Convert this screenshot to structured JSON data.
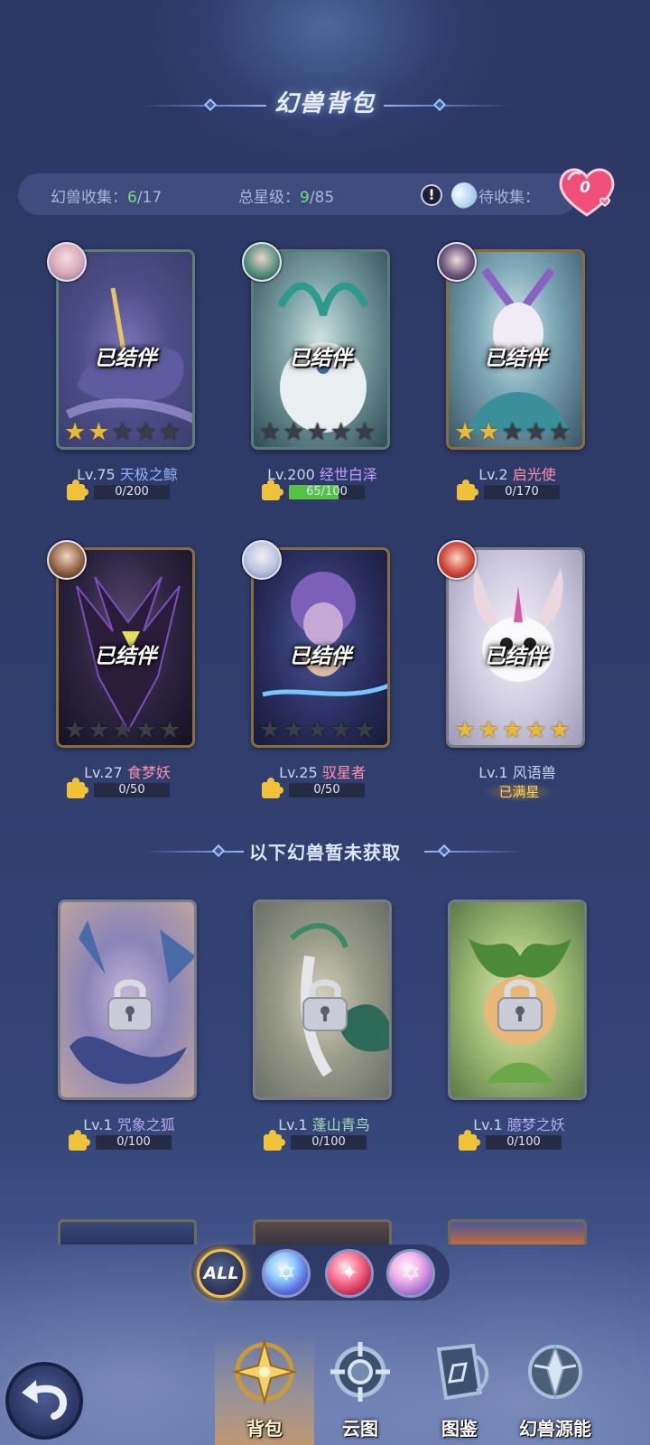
{
  "header": {
    "title": "幻兽背包"
  },
  "stats": {
    "collection_label": "幻兽收集：",
    "collection_owned": "6",
    "collection_total": "/17",
    "star_label": "总星级：",
    "star_owned": "9",
    "star_total": "/85",
    "pending_label": "待收集：",
    "heart_count": "0"
  },
  "owned_cards": [
    {
      "level": "Lv.75",
      "name": "天极之鲸",
      "status": "已结伴",
      "stars": 2,
      "progress_text": "0/200",
      "progress": 0
    },
    {
      "level": "Lv.200",
      "name": "经世白泽",
      "status": "已结伴",
      "stars": 0,
      "progress_text": "65/100",
      "progress": 0.65
    },
    {
      "level": "Lv.2",
      "name": "启光使",
      "status": "已结伴",
      "stars": 2,
      "progress_text": "0/170",
      "progress": 0
    },
    {
      "level": "Lv.27",
      "name": "食梦妖",
      "status": "已结伴",
      "stars": 0,
      "progress_text": "0/50",
      "progress": 0
    },
    {
      "level": "Lv.25",
      "name": "驭星者",
      "status": "已结伴",
      "stars": 0,
      "progress_text": "0/50",
      "progress": 0
    },
    {
      "level": "Lv.1",
      "name": "风语兽",
      "status": "已结伴",
      "stars": 5,
      "maxed_label": "已满星"
    }
  ],
  "locked_section_title": "以下幻兽暂未获取",
  "locked_cards": [
    {
      "level": "Lv.1",
      "name": "咒象之狐",
      "progress_text": "0/100",
      "progress": 0
    },
    {
      "level": "Lv.1",
      "name": "蓬山青鸟",
      "progress_text": "0/100",
      "progress": 0
    },
    {
      "level": "Lv.1",
      "name": "臆梦之妖",
      "progress_text": "0/100",
      "progress": 0
    }
  ],
  "filters": {
    "all_label": "ALL",
    "selected": "ALL"
  },
  "bottom_nav": {
    "items": [
      {
        "label": "背包",
        "active": true
      },
      {
        "label": "云图",
        "active": false
      },
      {
        "label": "图鉴",
        "active": false
      },
      {
        "label": "幻兽源能",
        "active": false
      }
    ]
  },
  "colors": {
    "accent_green": "#6fe07a",
    "gold": "#f0c23a",
    "star_on": "#e6b93a"
  }
}
